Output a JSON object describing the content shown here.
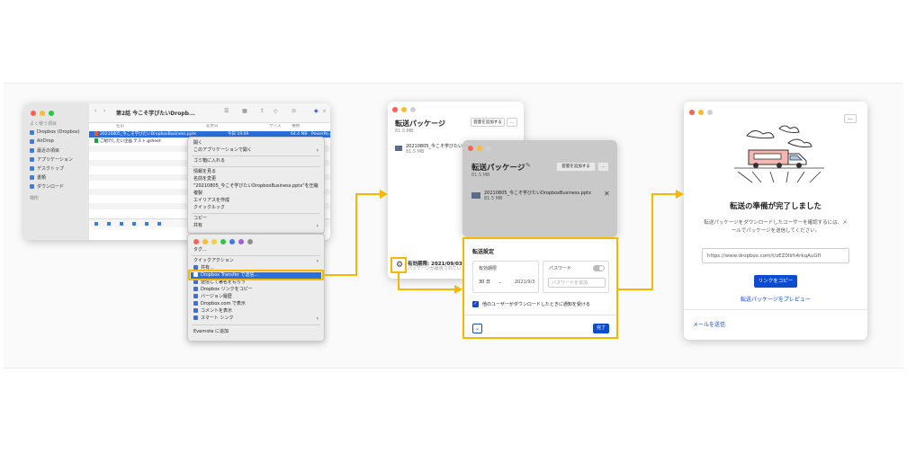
{
  "finder": {
    "title": "第2話 今こそ学びたいDropb...",
    "sidebar_header": "よく使う項目",
    "sidebar": [
      "Dropbox (Dropbox)",
      "AirDrop",
      "最近の項目",
      "アプリケーション",
      "デスクトップ",
      "書類",
      "ダウンロード"
    ],
    "sidebar_section": "場所",
    "columns": [
      "名前",
      "変更日",
      "サイズ",
      "種類"
    ],
    "files": [
      {
        "name": "20210805_今こそ学びたいDropboxBusiness.pptx",
        "date": "今日 19:09",
        "size": "64.4 MB",
        "kind": "PowerPo...ション(.pptx)"
      },
      {
        "name": "ご紹介したい企画 テスト.gsheet",
        "date": "",
        "size": "",
        "kind": ""
      }
    ]
  },
  "context_menu": {
    "items": [
      "開く",
      "このアプリケーションで開く",
      "ゴミ箱に入れる",
      "情報を見る",
      "名前を変更",
      "\"20210805_今こそ学びたいDropboxBusiness.pptx\"を圧縮",
      "複製",
      "エイリアスを作成",
      "クイックルック",
      "コピー",
      "共有"
    ],
    "tags": "タグ...",
    "quick_actions": "クイックアクション",
    "dropbox_items": [
      "共有...",
      "Dropbox Transfer で送信...",
      "送信して署名をもらう",
      "Dropbox リンクをコピー",
      "バージョン履歴",
      "Dropbox.com で表示",
      "コメントを表示",
      "スマート シンク"
    ],
    "evernote": "Evernote に追加",
    "tag_colors": [
      "#ff5f57",
      "#febc2e",
      "#f2d13c",
      "#28c840",
      "#3b7ce8",
      "#a25ddc",
      "#8e8e8e"
    ]
  },
  "transfer_back": {
    "title": "転送パッケージ",
    "size": "81.5 MB",
    "add_files": "容量を追加する",
    "file_name": "20210805_今こそ学びたいDropboxB...",
    "file_size": "81.5 MB",
    "expiry": "有効期限: 2021/09/03",
    "expiry_note": "パッケージが最後されています"
  },
  "transfer_front": {
    "title": "転送パッケージ",
    "size": "81.5 MB",
    "add_files": "容量を追加する",
    "more": "...",
    "file_name": "20210805_今こそ学びたいDropboxBusiness.pptx",
    "file_size": "81.5 MB"
  },
  "settings": {
    "heading": "転送設定",
    "expiry_label": "有効期限",
    "expiry_value": "30 日",
    "expiry_date": "2021/9/3",
    "password_label": "パスワード",
    "password_placeholder": "パスワードを追加",
    "notify_label": "他のユーザーがダウンロードしたときに通知を受ける",
    "done": "完了"
  },
  "ready": {
    "more": "...",
    "title": "転送の準備が完了しました",
    "desc": "転送パッケージをダウンロードしたユーザーを確認するには、メールでパッケージを送信してください。",
    "link": "https://www.dropbox.com/t/zEZ0Ilrh4rkqAuGfl",
    "copy_button": "リンクをコピー",
    "preview_link": "転送パッケージをプレビュー",
    "email_link": "メールを送信"
  },
  "accent": "#f5b700",
  "primary": "#0d4bd0"
}
